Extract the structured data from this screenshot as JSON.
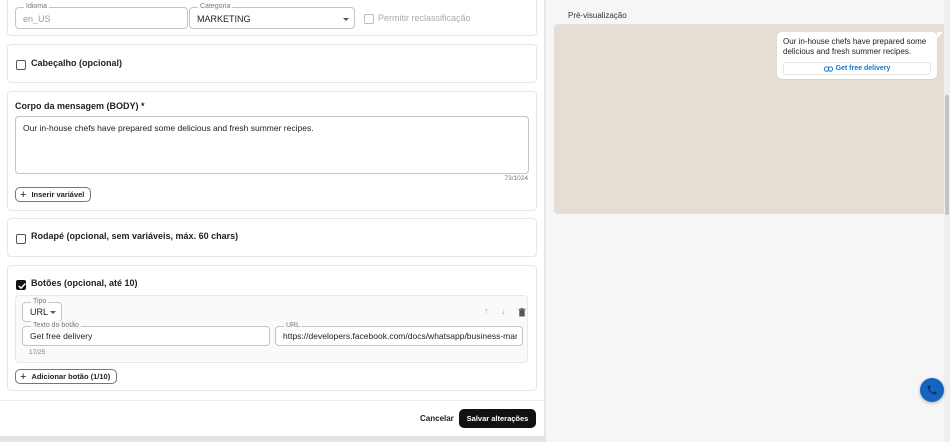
{
  "top_row": {
    "language": {
      "label": "Idioma",
      "value": "en_US"
    },
    "category": {
      "label": "Categoria",
      "value": "MARKETING"
    },
    "allow_recategorize": "Permitir reclassificação"
  },
  "header_section": {
    "label": "Cabeçalho (opcional)"
  },
  "body_section": {
    "label": "Corpo da mensagem (BODY) *",
    "text": "Our in-house chefs have prepared some delicious and fresh summer recipes.",
    "counter": "73/1024",
    "insert_variable": "Inserir variável"
  },
  "footer_section": {
    "label": "Rodapé (opcional, sem variáveis, máx. 60 chars)"
  },
  "buttons_section": {
    "label": "Botões (opcional, até 10)",
    "button": {
      "type_label": "Tipo",
      "type_value": "URL",
      "text_label": "Texto do botão",
      "text_value": "Get free delivery",
      "text_counter": "17/25",
      "url_label": "URL",
      "url_value": "https://developers.facebook.com/docs/whatsapp/business-management-api/message-templates"
    },
    "add_button": "Adicionar botão (1/10)"
  },
  "actions": {
    "cancel": "Cancelar",
    "save": "Salvar alterações"
  },
  "preview": {
    "title": "Pré-visualização",
    "message": "Our in-house chefs have prepared some delicious and fresh summer recipes.",
    "cta": "Get free delivery"
  },
  "colors": {
    "accent": "#1976d2",
    "preview_bg": "#e6ded5",
    "fab": "#1565c0",
    "primary_button": "#111111"
  }
}
